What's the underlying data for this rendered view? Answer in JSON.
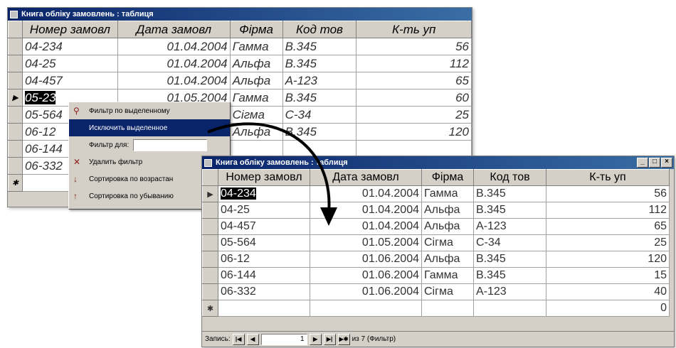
{
  "window1": {
    "title": "Книга обліку замовлень : таблиця",
    "columns": [
      "Номер замовл",
      "Дата замовл",
      "Фірма",
      "Код тов",
      "К-ть уп"
    ],
    "rows": [
      [
        "04-234",
        "01.04.2004",
        "Гамма",
        "B.345",
        "56"
      ],
      [
        "04-25",
        "01.04.2004",
        "Альфа",
        "B.345",
        "112"
      ],
      [
        "04-457",
        "01.04.2004",
        "Альфа",
        "A-123",
        "65"
      ],
      [
        "05-23",
        "01.05.2004",
        "Гамма",
        "B.345",
        "60"
      ],
      [
        "05-564",
        "",
        "Сігма",
        "C-34",
        "25"
      ],
      [
        "06-12",
        "",
        "Альфа",
        "B.345",
        "120"
      ],
      [
        "06-144",
        "",
        "",
        "",
        ""
      ],
      [
        "06-332",
        "",
        "",
        "",
        ""
      ]
    ],
    "current_row_marker": "▶",
    "new_row_marker": "✱"
  },
  "context_menu": {
    "items": [
      {
        "label": "Фильтр по выделенному",
        "icon": "filter-selection-icon"
      },
      {
        "label": "Исключить выделенное",
        "icon": ""
      },
      {
        "label": "Фильтр для:",
        "icon": ""
      },
      {
        "label": "Удалить фильтр",
        "icon": "remove-filter-icon"
      },
      {
        "label": "Сортировка по возрастан",
        "icon": "sort-ascending-icon"
      },
      {
        "label": "Сортировка по убыванию",
        "icon": "sort-descending-icon"
      }
    ]
  },
  "window2": {
    "title": "Книга обліку замовлень : таблиця",
    "columns": [
      "Номер замовл",
      "Дата замовл",
      "Фірма",
      "Код тов",
      "К-ть уп"
    ],
    "rows": [
      [
        "04-234",
        "01.04.2004",
        "Гамма",
        "B.345",
        "56"
      ],
      [
        "04-25",
        "01.04.2004",
        "Альфа",
        "B.345",
        "112"
      ],
      [
        "04-457",
        "01.04.2004",
        "Альфа",
        "A-123",
        "65"
      ],
      [
        "05-564",
        "01.05.2004",
        "Сігма",
        "C-34",
        "25"
      ],
      [
        "06-12",
        "01.06.2004",
        "Альфа",
        "B.345",
        "120"
      ],
      [
        "06-144",
        "01.06.2004",
        "Гамма",
        "B.345",
        "15"
      ],
      [
        "06-332",
        "01.06.2004",
        "Сігма",
        "A-123",
        "40"
      ]
    ],
    "new_row_qty": "0",
    "current_row_marker": "▶",
    "new_row_marker": "✱",
    "status": {
      "record_label": "Запись:",
      "record_number": "1",
      "of_text": "из 7 (Фильтр)"
    }
  }
}
